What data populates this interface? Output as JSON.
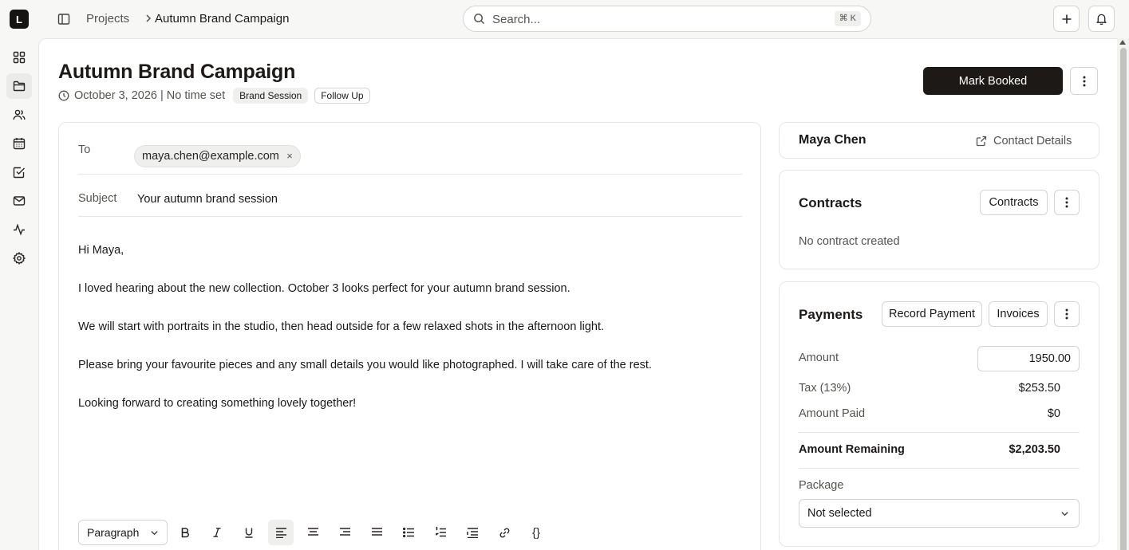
{
  "app": {
    "logo_letter": "L"
  },
  "sidebar": {
    "items": [
      {
        "name": "dashboard",
        "icon": "grid-icon"
      },
      {
        "name": "projects",
        "icon": "folder-icon",
        "active": true
      },
      {
        "name": "contacts",
        "icon": "users-icon"
      },
      {
        "name": "calendar",
        "icon": "calendar-icon"
      },
      {
        "name": "tasks",
        "icon": "checkbox-icon"
      },
      {
        "name": "mail",
        "icon": "mail-icon"
      },
      {
        "name": "activity",
        "icon": "activity-icon"
      },
      {
        "name": "settings",
        "icon": "gear-icon"
      }
    ]
  },
  "topbar": {
    "breadcrumb": {
      "parent": "Projects",
      "current": "Autumn Brand Campaign"
    },
    "search": {
      "placeholder": "Search...",
      "shortcut": "⌘ K"
    }
  },
  "project": {
    "title": "Autumn Brand Campaign",
    "date_text": "October 3, 2026 | No time set",
    "tags": [
      "Brand Session",
      "Follow Up"
    ],
    "primary_action": "Mark Booked"
  },
  "email": {
    "to_label": "To",
    "recipient": "maya.chen@example.com",
    "remove_symbol": "×",
    "subject_label": "Subject",
    "subject": "Your autumn brand session",
    "body": [
      "Hi Maya,",
      "I loved hearing about the new collection. October 3 looks perfect for your autumn brand session.",
      "We will start with portraits in the studio, then head outside for a few relaxed shots in the afternoon light.",
      "Please bring your favourite pieces and any small details you would like photographed. I will take care of the rest.",
      "Looking forward to creating something lovely together!"
    ],
    "toolbar": {
      "block_style": "Paragraph",
      "code_symbol": "{}",
      "active_alignment": "align-left"
    }
  },
  "contact": {
    "name": "Maya Chen",
    "details_link": "Contact Details"
  },
  "contracts": {
    "title": "Contracts",
    "button": "Contracts",
    "empty": "No contract created"
  },
  "payments": {
    "title": "Payments",
    "record_button": "Record Payment",
    "invoices_button": "Invoices",
    "amount_label": "Amount",
    "amount_value": "1950.00",
    "tax_label": "Tax (13%)",
    "tax_value": "$253.50",
    "paid_label": "Amount Paid",
    "paid_value": "$0",
    "remaining_label": "Amount Remaining",
    "remaining_value": "$2,203.50",
    "package_label": "Package",
    "package_value": "Not selected"
  },
  "colors": {
    "primary_button": "#1c1917",
    "background": "#f7f7f6",
    "border": "#e7e5e4",
    "muted_text": "#57534e"
  }
}
